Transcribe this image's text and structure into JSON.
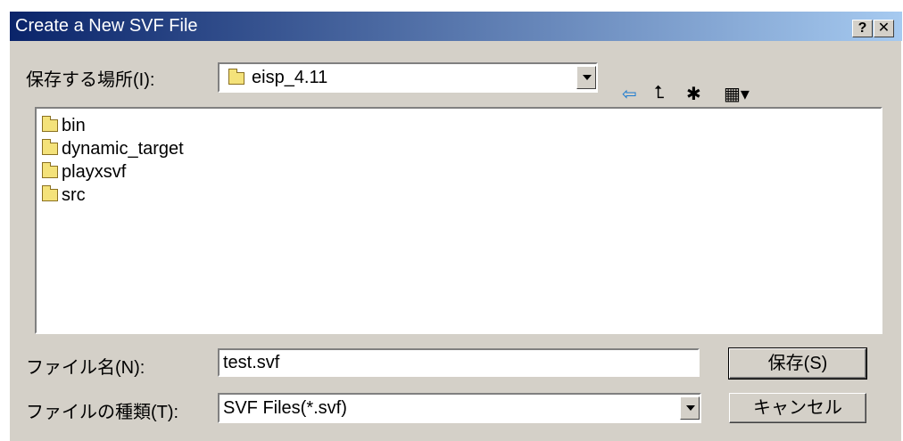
{
  "window": {
    "title": "Create a New SVF File",
    "help_label": "?",
    "close_label": "✕"
  },
  "location": {
    "label": "保存する場所(I):",
    "current": "eisp_4.11"
  },
  "toolbar": {
    "back_glyph": "⇦",
    "up_glyph": "⮤",
    "newfolder_glyph": "✱",
    "view_glyph": "▦▾"
  },
  "files": [
    {
      "name": "bin",
      "icon": "folder-icon"
    },
    {
      "name": "dynamic_target",
      "icon": "folder-icon"
    },
    {
      "name": "playxsvf",
      "icon": "folder-icon"
    },
    {
      "name": "src",
      "icon": "folder-icon"
    }
  ],
  "filename": {
    "label": "ファイル名(N):",
    "value": "test.svf"
  },
  "filetype": {
    "label": "ファイルの種類(T):",
    "value": "SVF Files(*.svf)"
  },
  "buttons": {
    "save": "保存(S)",
    "cancel": "キャンセル"
  },
  "colors": {
    "titlebar_start": "#0a246a",
    "titlebar_end": "#a6caf0",
    "face": "#d4d0c8"
  }
}
